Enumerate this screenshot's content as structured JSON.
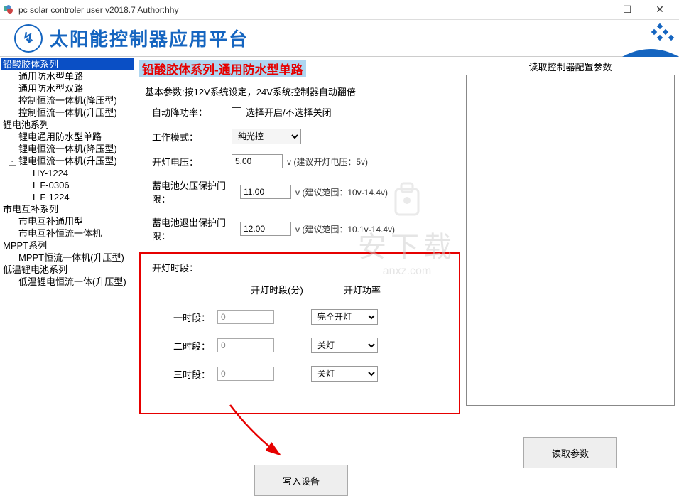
{
  "window": {
    "title": "pc solar controler user v2018.7 Author:hhy"
  },
  "banner": {
    "title": "太阳能控制器应用平台"
  },
  "tree": {
    "roots": [
      {
        "label": "铅酸胶体系列",
        "selected": true,
        "children": [
          {
            "label": "通用防水型单路"
          },
          {
            "label": "通用防水型双路"
          },
          {
            "label": "控制恒流一体机(降压型)"
          },
          {
            "label": "控制恒流一体机(升压型)"
          }
        ]
      },
      {
        "label": "锂电池系列",
        "children": [
          {
            "label": "锂电通用防水型单路"
          },
          {
            "label": "锂电恒流一体机(降压型)"
          },
          {
            "label": "锂电恒流一体机(升压型)",
            "expander": "-",
            "children": [
              {
                "label": "HY-1224"
              },
              {
                "label": "L F-0306"
              },
              {
                "label": "L F-1224"
              }
            ]
          }
        ]
      },
      {
        "label": "市电互补系列",
        "children": [
          {
            "label": "市电互补通用型"
          },
          {
            "label": "市电互补恒流一体机"
          }
        ]
      },
      {
        "label": "MPPT系列",
        "children": [
          {
            "label": "MPPT恒流一体机(升压型)"
          }
        ]
      },
      {
        "label": "低温锂电池系列",
        "children": [
          {
            "label": "低温锂电恒流一体(升压型)"
          }
        ]
      }
    ]
  },
  "form": {
    "breadcrumb": "铅酸胶体系列-通用防水型单路",
    "note": "基本参数:按12V系统设定，24V系统控制器自动翻倍",
    "auto_power_label": "自动降功率：",
    "auto_power_checkbox": "选择开启/不选择关闭",
    "work_mode_label": "工作模式：",
    "work_mode_value": "纯光控",
    "on_voltage_label": "开灯电压：",
    "on_voltage_value": "5.00",
    "on_voltage_hint": "v (建议开灯电压：5v)",
    "undervolt_label": "蓄电池欠压保护门限：",
    "undervolt_value": "11.00",
    "undervolt_hint": "v (建议范围：10v-14.4v)",
    "exit_label": "蓄电池退出保护门限：",
    "exit_value": "12.00",
    "exit_hint": "v (建议范围：10.1v-14.4v)",
    "section_title": "开灯时段：",
    "col_time": "开灯时段(分)",
    "col_power": "开灯功率",
    "periods": [
      {
        "label": "一时段：",
        "minutes": "0",
        "power": "完全开灯"
      },
      {
        "label": "二时段：",
        "minutes": "0",
        "power": "关灯"
      },
      {
        "label": "三时段：",
        "minutes": "0",
        "power": "关灯"
      }
    ],
    "write_btn": "写入设备"
  },
  "right": {
    "title": "读取控制器配置参数",
    "read_btn": "读取参数"
  },
  "watermark": {
    "line1": "安下载",
    "line2": "anxz.com"
  }
}
